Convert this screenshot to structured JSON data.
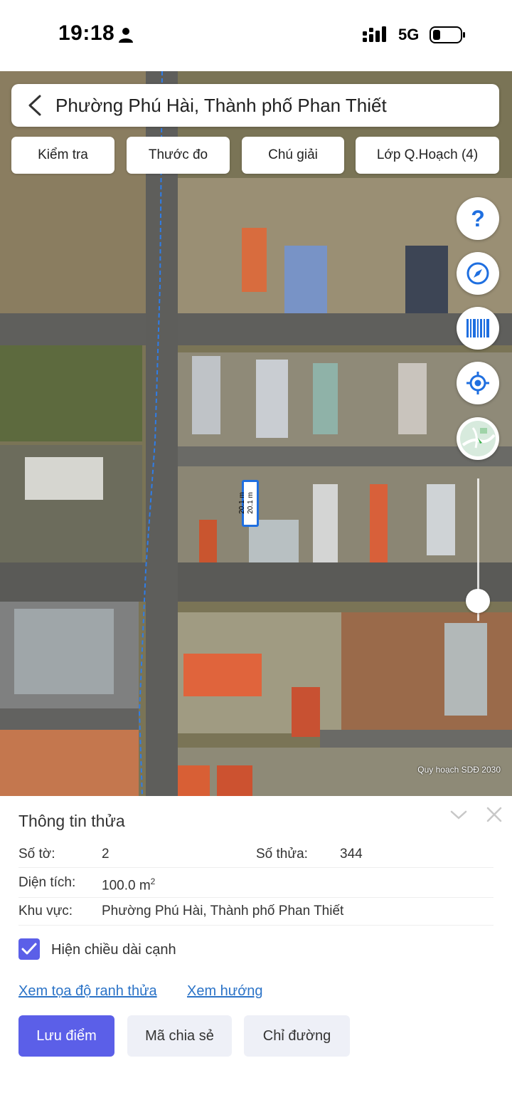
{
  "status_bar": {
    "time": "19:18",
    "network": "5G"
  },
  "map": {
    "search_title": "Phường Phú Hài, Thành phố Phan Thiết",
    "tools": [
      "Kiểm tra",
      "Thước đo",
      "Chú giải",
      "Lớp Q.Hoạch (4)"
    ],
    "fab_icons": [
      "help-icon",
      "compass-icon",
      "barcode-icon",
      "locate-icon",
      "map-layer-icon"
    ],
    "help_symbol": "?",
    "parcel_edges": [
      "20.1 m",
      "20.1 m"
    ],
    "attribution": "Quy hoạch SDĐ 2030",
    "accent_color": "#1f6fe0"
  },
  "sheet": {
    "title": "Thông tin thửa",
    "so_to_label": "Số tờ:",
    "so_to_value": "2",
    "so_thua_label": "Số thửa:",
    "so_thua_value": "344",
    "dien_tich_label": "Diện tích:",
    "dien_tich_value": "100.0 m",
    "dien_tich_unit_sup": "2",
    "khu_vuc_label": "Khu vực:",
    "khu_vuc_value": "Phường Phú Hài, Thành phố Phan Thiết",
    "checkbox_label": "Hiện chiều dài cạnh",
    "checkbox_checked": true,
    "link_coords": "Xem tọa độ ranh thửa",
    "link_direction": "Xem hướng",
    "btn_save": "Lưu điểm",
    "btn_share": "Mã chia sẻ",
    "btn_directions": "Chỉ đường",
    "primary_color": "#5b5fe8"
  }
}
